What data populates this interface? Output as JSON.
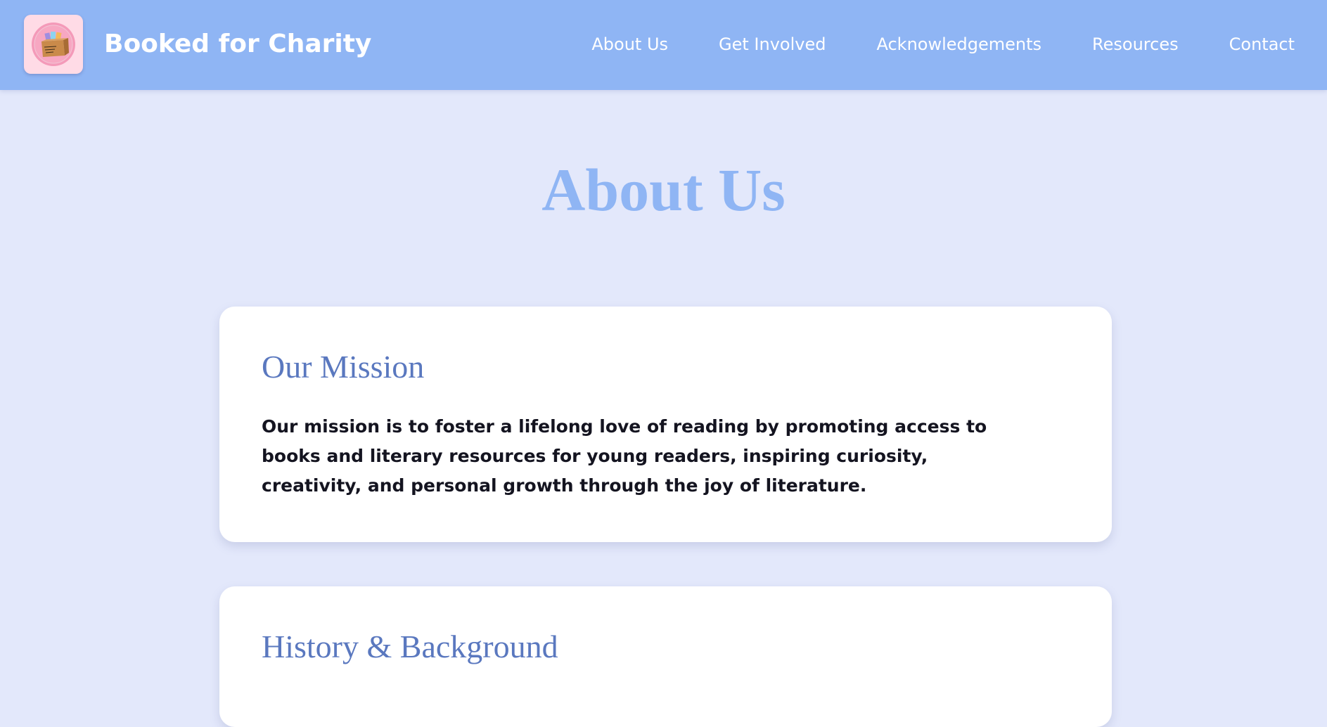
{
  "header": {
    "site_title": "Booked for Charity",
    "logo_icon": "book-box-logo-icon",
    "nav": [
      {
        "label": "About Us"
      },
      {
        "label": "Get Involved"
      },
      {
        "label": "Acknowledgements"
      },
      {
        "label": "Resources"
      },
      {
        "label": "Contact"
      }
    ]
  },
  "main": {
    "page_title": "About Us",
    "sections": [
      {
        "heading": "Our Mission",
        "body": "Our mission is to foster a lifelong love of reading by promoting access to books and literary resources for young readers, inspiring curiosity, creativity, and personal growth through the joy of literature."
      },
      {
        "heading": "History & Background"
      }
    ]
  },
  "colors": {
    "header_bg": "#8fb5f4",
    "page_bg": "#e3e8fb",
    "title": "#8fb5f4",
    "section_heading": "#5a78bf",
    "card_bg": "#ffffff",
    "logo_bg": "#ffdbe6"
  }
}
